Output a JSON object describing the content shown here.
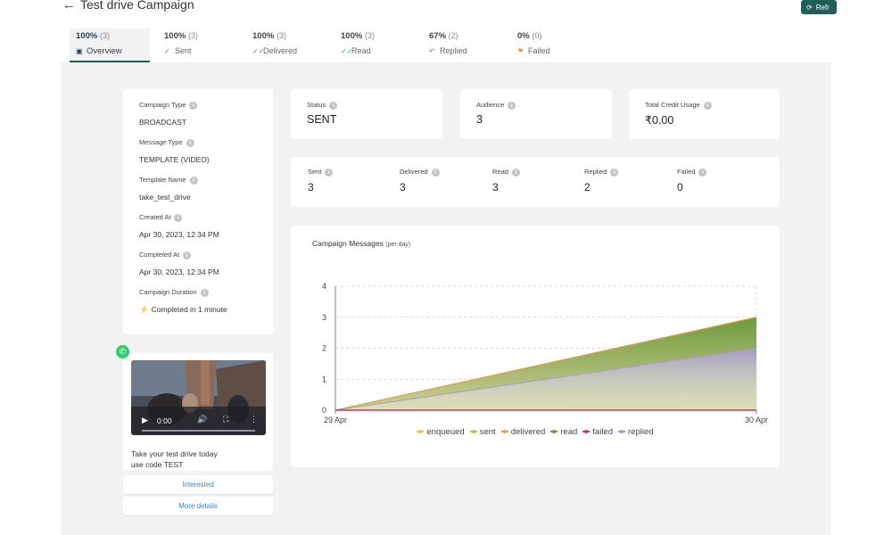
{
  "header": {
    "back_icon": "arrow-left-icon",
    "title": "Test drive Campaign",
    "refresh_label": "Refr"
  },
  "tabs": [
    {
      "pct": "100%",
      "count": "(3)",
      "label": "Overview",
      "icon": "chart-icon"
    },
    {
      "pct": "100%",
      "count": "(3)",
      "label": "Sent",
      "icon": "check-icon"
    },
    {
      "pct": "100%",
      "count": "(3)",
      "label": "Delivered",
      "icon": "double-check-icon"
    },
    {
      "pct": "100%",
      "count": "(3)",
      "label": "Read",
      "icon": "double-check-green-icon"
    },
    {
      "pct": "67%",
      "count": "(2)",
      "label": "Replied",
      "icon": "reply-icon"
    },
    {
      "pct": "0%",
      "count": "(0)",
      "label": "Failed",
      "icon": "flag-icon"
    }
  ],
  "details": {
    "campaign_type_label": "Campaign Type",
    "campaign_type": "BROADCAST",
    "message_type_label": "Message Type",
    "message_type": "TEMPLATE (VIDEO)",
    "template_name_label": "Template Name",
    "template_name": "take_test_drive",
    "created_at_label": "Created At",
    "created_at": "Apr 30, 2023, 12:34 PM",
    "completed_at_label": "Completed At",
    "completed_at": "Apr 30, 2023, 12:34 PM",
    "duration_label": "Campaign Duration",
    "duration": "Completed in 1 minute"
  },
  "summary": {
    "status_label": "Status",
    "status": "SENT",
    "audience_label": "Audience",
    "audience": "3",
    "credit_label": "Total Credit Usage",
    "credit": "₹0.00"
  },
  "metrics": [
    {
      "label": "Sent",
      "value": "3"
    },
    {
      "label": "Delivered",
      "value": "3"
    },
    {
      "label": "Read",
      "value": "3"
    },
    {
      "label": "Replied",
      "value": "2"
    },
    {
      "label": "Failed",
      "value": "0"
    }
  ],
  "preview": {
    "badge_icon": "whatsapp-icon",
    "video_time": "0:00",
    "text": "Take your test drive today\nuse code TEST",
    "buttons": [
      "Interested",
      "More details"
    ]
  },
  "chart_data": {
    "type": "area",
    "title": "Campaign Messages",
    "title_note": "(per day)",
    "x": [
      "29 Apr",
      "30 Apr"
    ],
    "ylim": [
      0,
      4
    ],
    "yticks": [
      "0",
      "1",
      "2",
      "3",
      "4"
    ],
    "grid": true,
    "legend_position": "bottom",
    "series": [
      {
        "name": "enqueued",
        "values": [
          0,
          0
        ],
        "color": "#e8c24a"
      },
      {
        "name": "sent",
        "values": [
          0,
          3
        ],
        "color": "#b7c24a"
      },
      {
        "name": "delivered",
        "values": [
          0,
          3
        ],
        "color": "#e3a04a"
      },
      {
        "name": "read",
        "values": [
          0,
          3
        ],
        "color": "#6d9a3c"
      },
      {
        "name": "failed",
        "values": [
          0,
          0
        ],
        "color": "#d6306a"
      },
      {
        "name": "replied",
        "values": [
          0,
          2
        ],
        "color": "#a79ac8"
      }
    ]
  }
}
